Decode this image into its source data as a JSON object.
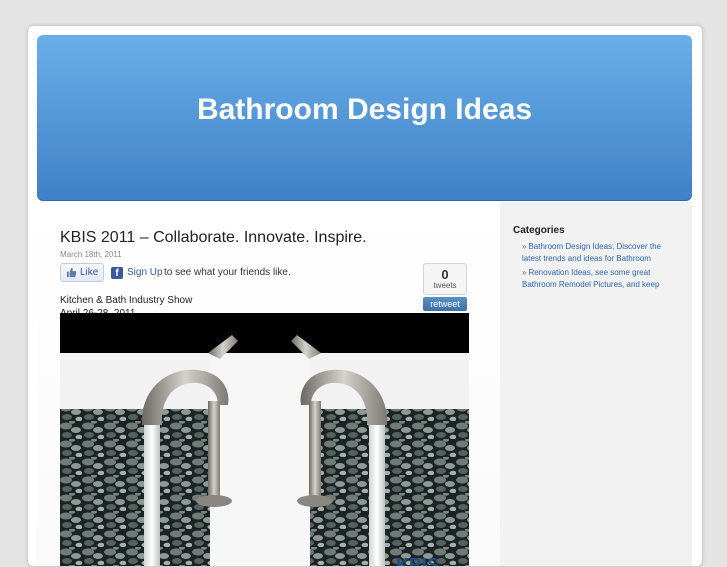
{
  "site": {
    "title": "Bathroom Design Ideas"
  },
  "post": {
    "title": "KBIS 2011 – Collaborate. Innovate. Inspire.",
    "date": "March 18th, 2011",
    "body_line1": "Kitchen & Bath Industry Show",
    "body_line2": "April 26-28, 2011"
  },
  "social": {
    "like_label": "Like",
    "facebook_glyph": "f",
    "signup_link": "Sign Up",
    "signup_text": "to see what your friends like.",
    "tweet_count": "0",
    "tweet_label": "tweets",
    "retweet_label": "retweet"
  },
  "image": {
    "watermark": "KBIS"
  },
  "sidebar": {
    "heading": "Categories",
    "items": [
      {
        "arrow": "»",
        "label": "Bathroom Design Ideas; Discover the latest trends and ideas for Bathroom"
      },
      {
        "arrow": "»",
        "label": "Renovation Ideas, see some great Bathroom Remodel Pictures, and keep"
      }
    ]
  },
  "colors": {
    "header_top": "#6aaee9",
    "header_bottom": "#3f81c6",
    "link": "#2a66b0",
    "facebook": "#3b5998"
  },
  "icons": [
    "thumbs-up-icon",
    "facebook-icon"
  ]
}
